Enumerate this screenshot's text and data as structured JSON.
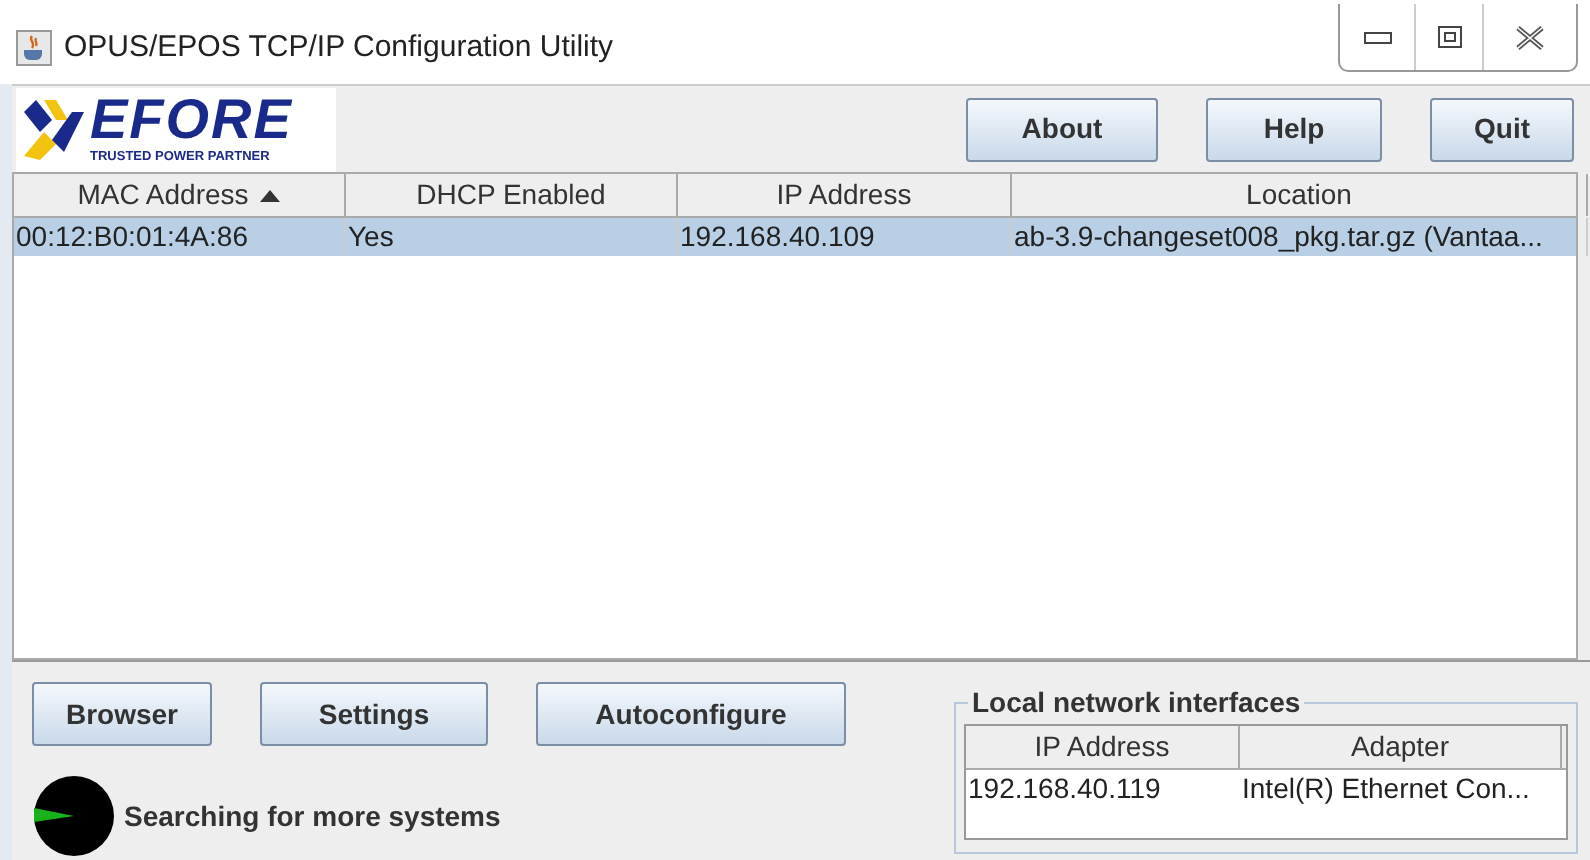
{
  "window": {
    "title": "OPUS/EPOS TCP/IP Configuration Utility"
  },
  "logo": {
    "name": "EFORE",
    "tagline": "TRUSTED POWER PARTNER"
  },
  "toolbar_buttons": [
    "About",
    "Help",
    "Quit"
  ],
  "table": {
    "columns": [
      {
        "label": "MAC Address",
        "sorted": true
      },
      {
        "label": "DHCP Enabled",
        "sorted": false
      },
      {
        "label": "IP Address",
        "sorted": false
      },
      {
        "label": "Location",
        "sorted": false
      }
    ],
    "rows": [
      {
        "selected": true,
        "cells": [
          "00:12:B0:01:4A:86",
          "Yes",
          "192.168.40.109",
          "ab-3.9-changeset008_pkg.tar.gz (Vantaa..."
        ]
      }
    ]
  },
  "action_buttons": [
    "Browser",
    "Settings",
    "Autoconfigure"
  ],
  "status": {
    "text": "Searching for more systems"
  },
  "local_interfaces": {
    "title": "Local network interfaces",
    "columns": [
      "IP Address",
      "Adapter"
    ],
    "rows": [
      [
        "192.168.40.119",
        "Intel(R) Ethernet Con..."
      ]
    ]
  }
}
